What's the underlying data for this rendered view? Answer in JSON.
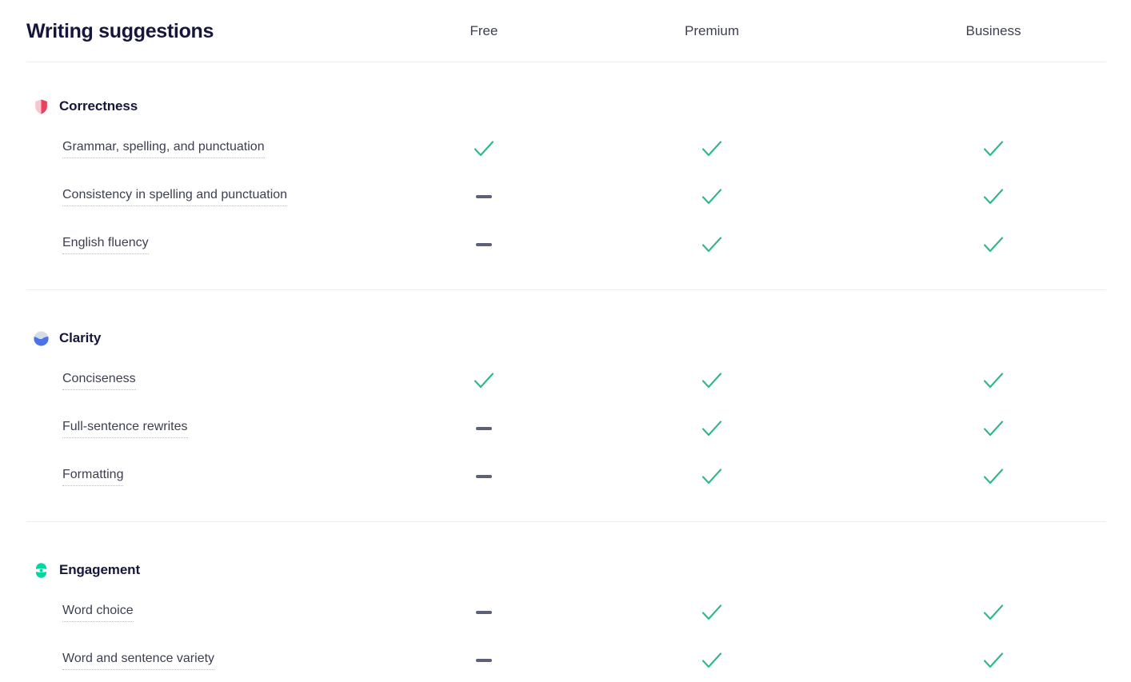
{
  "header": {
    "title": "Writing suggestions",
    "plans": [
      "Free",
      "Premium",
      "Business"
    ]
  },
  "colors": {
    "check": "#2db887",
    "dash": "#5c6078",
    "title": "#14173a",
    "text": "#3c3f51",
    "rule": "#eceef2",
    "correctness_icon_light": "#f9c6cf",
    "correctness_icon_dark": "#e8445f",
    "clarity_icon_light": "#d6dbe8",
    "clarity_icon_dark": "#4b72e8",
    "engagement_icon": "#06d6a0"
  },
  "icons": {
    "correctness": "shield-icon",
    "clarity": "wave-circle-icon",
    "engagement": "eye-capsule-icon",
    "check": "check-icon",
    "dash": "dash-icon"
  },
  "sections": [
    {
      "id": "correctness",
      "title": "Correctness",
      "icon": "shield-icon",
      "rows": [
        {
          "label": "Grammar, spelling, and punctuation",
          "free": "check",
          "premium": "check",
          "business": "check"
        },
        {
          "label": "Consistency in spelling and punctuation",
          "free": "dash",
          "premium": "check",
          "business": "check"
        },
        {
          "label": "English fluency",
          "free": "dash",
          "premium": "check",
          "business": "check"
        }
      ]
    },
    {
      "id": "clarity",
      "title": "Clarity",
      "icon": "wave-circle-icon",
      "rows": [
        {
          "label": "Conciseness",
          "free": "check",
          "premium": "check",
          "business": "check"
        },
        {
          "label": "Full-sentence rewrites",
          "free": "dash",
          "premium": "check",
          "business": "check"
        },
        {
          "label": "Formatting",
          "free": "dash",
          "premium": "check",
          "business": "check"
        }
      ]
    },
    {
      "id": "engagement",
      "title": "Engagement",
      "icon": "eye-capsule-icon",
      "rows": [
        {
          "label": "Word choice",
          "free": "dash",
          "premium": "check",
          "business": "check"
        },
        {
          "label": "Word and sentence variety",
          "free": "dash",
          "premium": "check",
          "business": "check"
        }
      ]
    }
  ]
}
